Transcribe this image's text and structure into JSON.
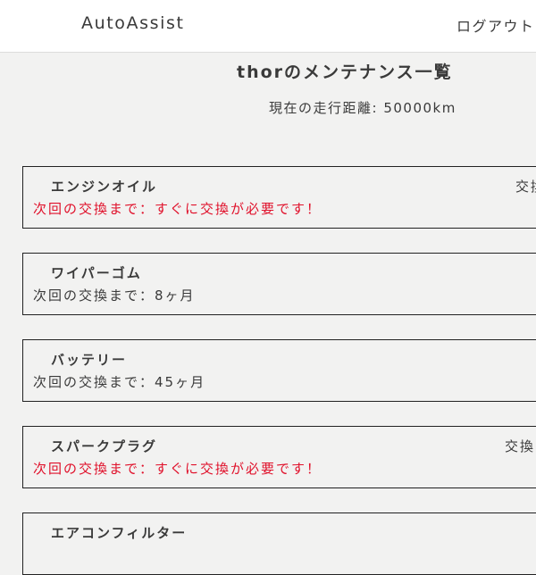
{
  "header": {
    "brand": "AutoAssist",
    "logout_label": "ログアウト"
  },
  "main": {
    "title": "thorのメンテナンス一覧",
    "mileage": "現在の走行距離: 50000km"
  },
  "items": [
    {
      "name": "エンジンオイル",
      "status": "次回の交換まで：すぐに交換が必要です！",
      "urgent": true,
      "action": "交換"
    },
    {
      "name": "ワイパーゴム",
      "status": "次回の交換まで：8ヶ月",
      "urgent": false,
      "action": ""
    },
    {
      "name": "バッテリー",
      "status": "次回の交換まで：45ヶ月",
      "urgent": false,
      "action": ""
    },
    {
      "name": "スパークプラグ",
      "status": "次回の交換まで：すぐに交換が必要です！",
      "urgent": true,
      "action": "交換"
    },
    {
      "name": "エアコンフィルター",
      "status": "",
      "urgent": false,
      "action": ""
    }
  ],
  "colors": {
    "urgent": "#e0102a",
    "text": "#3a3a3a",
    "background": "#f2f2f1"
  }
}
